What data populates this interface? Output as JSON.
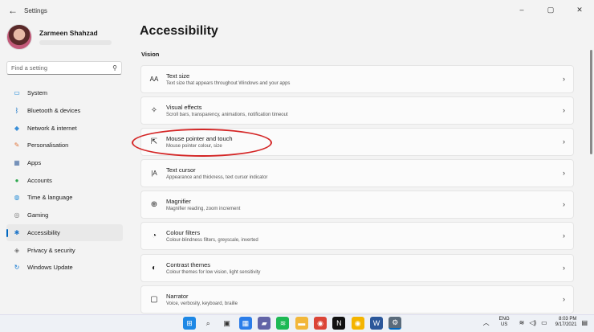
{
  "window": {
    "title": "Settings",
    "controls": [
      "–",
      "▢",
      "✕"
    ]
  },
  "profile": {
    "name": "Zarmeen Shahzad"
  },
  "search": {
    "placeholder": "Find a setting"
  },
  "sidebar": {
    "items": [
      {
        "label": "System",
        "icon": "monitor-icon",
        "color": "#0078d4"
      },
      {
        "label": "Bluetooth & devices",
        "icon": "bluetooth-icon",
        "color": "#0067c0"
      },
      {
        "label": "Network & internet",
        "icon": "wifi-icon",
        "color": "#3a8fd8"
      },
      {
        "label": "Personalisation",
        "icon": "brush-icon",
        "color": "#e0743a"
      },
      {
        "label": "Apps",
        "icon": "apps-icon",
        "color": "#4a6fa5"
      },
      {
        "label": "Accounts",
        "icon": "person-icon",
        "color": "#2ea84f"
      },
      {
        "label": "Time & language",
        "icon": "globe-icon",
        "color": "#2b8fd6"
      },
      {
        "label": "Gaming",
        "icon": "controller-icon",
        "color": "#777777"
      },
      {
        "label": "Accessibility",
        "icon": "accessibility-icon",
        "color": "#1a73c8",
        "active": true
      },
      {
        "label": "Privacy & security",
        "icon": "shield-icon",
        "color": "#777777"
      },
      {
        "label": "Windows Update",
        "icon": "update-icon",
        "color": "#0a73d0"
      }
    ]
  },
  "main": {
    "title": "Accessibility",
    "section": "Vision",
    "cards": [
      {
        "title": "Text size",
        "subtitle": "Text size that appears throughout Windows and your apps",
        "icon": "text-size-icon"
      },
      {
        "title": "Visual effects",
        "subtitle": "Scroll bars, transparency, animations, notification timeout",
        "icon": "sparkle-icon"
      },
      {
        "title": "Mouse pointer and touch",
        "subtitle": "Mouse pointer colour, size",
        "icon": "mouse-pointer-icon"
      },
      {
        "title": "Text cursor",
        "subtitle": "Appearance and thickness, text cursor indicator",
        "icon": "text-cursor-icon"
      },
      {
        "title": "Magnifier",
        "subtitle": "Magnifier reading, zoom increment",
        "icon": "magnifier-icon"
      },
      {
        "title": "Colour filters",
        "subtitle": "Colour-blindness filters, greyscale, inverted",
        "icon": "colour-filter-icon"
      },
      {
        "title": "Contrast themes",
        "subtitle": "Colour themes for low vision, light sensitivity",
        "icon": "contrast-icon"
      },
      {
        "title": "Narrator",
        "subtitle": "Voice, verbosity, keyboard, braille",
        "icon": "narrator-icon"
      }
    ]
  },
  "taskbar": {
    "apps": [
      {
        "name": "start-icon",
        "color": "#1e88e5",
        "glyph": "⊞"
      },
      {
        "name": "search-icon",
        "color": "#333333",
        "glyph": "⌕"
      },
      {
        "name": "task-view-icon",
        "color": "#333333",
        "glyph": "▣"
      },
      {
        "name": "widgets-icon",
        "color": "#2b7de9",
        "glyph": "▦"
      },
      {
        "name": "chat-icon",
        "color": "#6264a7",
        "glyph": "▰"
      },
      {
        "name": "spotify-icon",
        "color": "#1db954",
        "glyph": "≋"
      },
      {
        "name": "file-explorer-icon",
        "color": "#f2b73a",
        "glyph": "▬"
      },
      {
        "name": "chrome-icon",
        "color": "#db4437",
        "glyph": "◉"
      },
      {
        "name": "netflix-icon",
        "color": "#111111",
        "glyph": "N"
      },
      {
        "name": "chrome-canary-icon",
        "color": "#f4b400",
        "glyph": "◉"
      },
      {
        "name": "word-icon",
        "color": "#2b579a",
        "glyph": "W"
      },
      {
        "name": "settings-icon",
        "color": "#5a6b7b",
        "glyph": "⚙",
        "active": true
      }
    ],
    "language_top": "ENG",
    "language_bottom": "US",
    "time": "8:03 PM",
    "date": "9/17/2021"
  }
}
